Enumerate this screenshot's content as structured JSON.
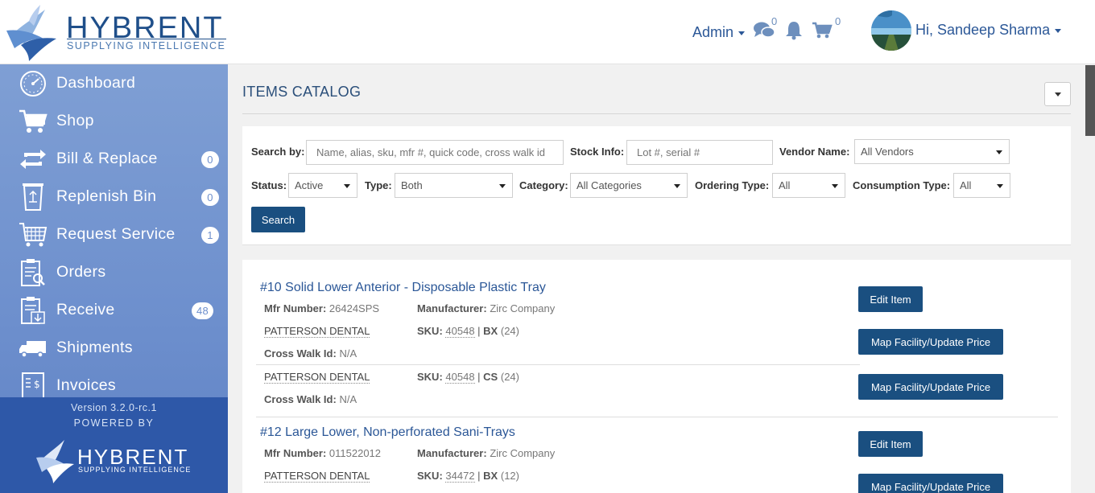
{
  "header": {
    "logo_text": "HYBRENT",
    "logo_sub": "SUPPLYING INTELLIGENCE",
    "admin_label": "Admin",
    "chat_count": "0",
    "cart_count": "0",
    "user_greeting": "Hi, Sandeep Sharma"
  },
  "sidebar": {
    "items": [
      {
        "label": "Dashboard",
        "icon": "dashboard-icon"
      },
      {
        "label": "Shop",
        "icon": "cart-icon"
      },
      {
        "label": "Bill & Replace",
        "icon": "bill-replace-icon",
        "count": "0"
      },
      {
        "label": "Replenish Bin",
        "icon": "recycle-bin-icon",
        "count": "0"
      },
      {
        "label": "Request Service",
        "icon": "request-service-icon",
        "count": "1"
      },
      {
        "label": "Orders",
        "icon": "orders-icon"
      },
      {
        "label": "Receive",
        "icon": "receive-icon",
        "count": "48"
      },
      {
        "label": "Shipments",
        "icon": "truck-icon"
      },
      {
        "label": "Invoices",
        "icon": "invoice-icon"
      }
    ],
    "version": "Version 3.2.0-rc.1",
    "powered_by": "POWERED BY",
    "footer_logo_text": "HYBRENT",
    "footer_logo_sub": "SUPPLYING INTELLIGENCE"
  },
  "main": {
    "title": "ITEMS CATALOG",
    "filters": {
      "search_by_label": "Search by:",
      "search_by_placeholder": "Name, alias, sku, mfr #, quick code, cross walk id",
      "stock_info_label": "Stock Info:",
      "stock_info_placeholder": "Lot #, serial #",
      "vendor_label": "Vendor Name:",
      "vendor_value": "All Vendors",
      "status_label": "Status:",
      "status_value": "Active",
      "type_label": "Type:",
      "type_value": "Both",
      "category_label": "Category:",
      "category_value": "All Categories",
      "ordering_label": "Ordering Type:",
      "ordering_value": "All",
      "consumption_label": "Consumption Type:",
      "consumption_value": "All",
      "search_button": "Search"
    },
    "labels": {
      "mfr_number": "Mfr Number:",
      "manufacturer": "Manufacturer:",
      "sku": "SKU:",
      "cross_walk": "Cross Walk Id:",
      "edit_item": "Edit Item",
      "map_facility": "Map Facility/Update Price"
    },
    "items": [
      {
        "title": "#10 Solid Lower Anterior - Disposable Plastic Tray",
        "mfr_number": "26424SPS",
        "manufacturer": "Zirc Company",
        "vendors": [
          {
            "vendor": "PATTERSON DENTAL",
            "sku": "40548",
            "uom": "BX",
            "qty": "(24)",
            "cross_walk": "N/A"
          },
          {
            "vendor": "PATTERSON DENTAL",
            "sku": "40548",
            "uom": "CS",
            "qty": "(24)",
            "cross_walk": "N/A"
          }
        ]
      },
      {
        "title": "#12 Large Lower, Non-perforated Sani-Trays",
        "mfr_number": "011522012",
        "manufacturer": "Zirc Company",
        "vendors": [
          {
            "vendor": "PATTERSON DENTAL",
            "sku": "34472",
            "uom": "BX",
            "qty": "(12)"
          }
        ]
      }
    ]
  }
}
